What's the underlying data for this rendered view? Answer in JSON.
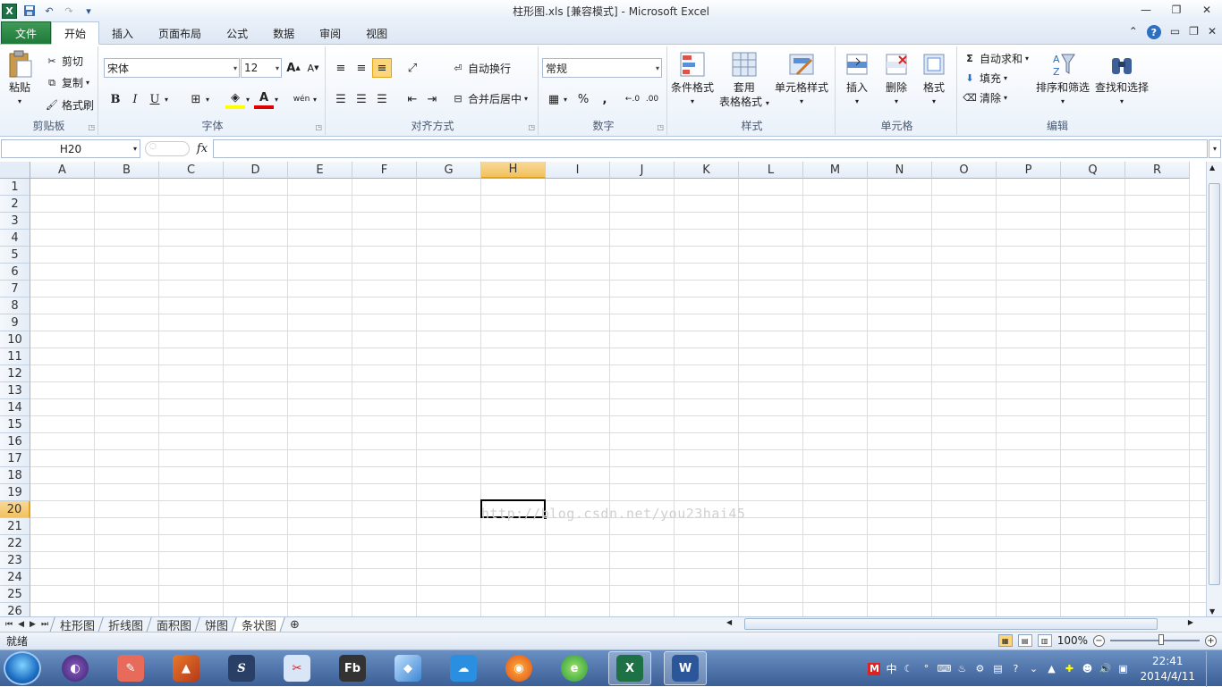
{
  "window": {
    "title": "柱形图.xls  [兼容模式] - Microsoft Excel",
    "controls": {
      "minimize": "—",
      "restore": "❐",
      "close": "✕"
    }
  },
  "quick_access": {
    "icons": [
      "excel-icon",
      "save-icon",
      "undo-icon",
      "redo-icon",
      "customize-icon"
    ]
  },
  "tabs": [
    {
      "label": "文件"
    },
    {
      "label": "开始"
    },
    {
      "label": "插入"
    },
    {
      "label": "页面布局"
    },
    {
      "label": "公式"
    },
    {
      "label": "数据"
    },
    {
      "label": "审阅"
    },
    {
      "label": "视图"
    }
  ],
  "active_tab": "开始",
  "ribbon": {
    "clipboard": {
      "label": "剪贴板",
      "paste": "粘贴",
      "cut": "剪切",
      "copy": "复制",
      "painter": "格式刷"
    },
    "font": {
      "label": "字体",
      "name": "宋体",
      "size": "12",
      "bold": "B",
      "italic": "I",
      "underline": "U",
      "grow": "A",
      "shrink": "A",
      "color": "A",
      "wen": "wén"
    },
    "alignment": {
      "label": "对齐方式",
      "wrap": "自动换行",
      "merge": "合并后居中"
    },
    "number": {
      "label": "数字",
      "format": "常规",
      "percent": "%",
      "comma": ","
    },
    "styles": {
      "label": "样式",
      "conditional": "条件格式",
      "table1": "套用",
      "table2": "表格格式",
      "cell": "单元格样式"
    },
    "cells": {
      "label": "单元格",
      "insert": "插入",
      "delete": "删除",
      "format": "格式"
    },
    "editing": {
      "label": "编辑",
      "autosum": "自动求和",
      "fill": "填充",
      "clear": "清除",
      "sort": "排序和筛选",
      "find": "查找和选择"
    }
  },
  "formula_bar": {
    "name_box": "H20",
    "fx": "fx",
    "formula": ""
  },
  "grid": {
    "columns": [
      "A",
      "B",
      "C",
      "D",
      "E",
      "F",
      "G",
      "H",
      "I",
      "J",
      "K",
      "L",
      "M",
      "N",
      "O",
      "P",
      "Q",
      "R"
    ],
    "rows": [
      "1",
      "2",
      "3",
      "4",
      "5",
      "6",
      "7",
      "8",
      "9",
      "10",
      "11",
      "12",
      "13",
      "14",
      "15",
      "16",
      "17",
      "18",
      "19",
      "20",
      "21",
      "22",
      "23",
      "24",
      "25",
      "26"
    ],
    "selected_column": "H",
    "selected_row": "20",
    "watermark": "http://blog.csdn.net/you23hai45"
  },
  "sheets": [
    {
      "label": "柱形图"
    },
    {
      "label": "折线图"
    },
    {
      "label": "面积图"
    },
    {
      "label": "饼图"
    },
    {
      "label": "条状图"
    }
  ],
  "active_sheet": "条状图",
  "status": {
    "ready": "就绪",
    "zoom": "100%"
  },
  "taskbar": {
    "apps": [
      "eclipse-icon",
      "sticky-icon",
      "matlab-icon",
      "s-app-icon",
      "scissors-icon",
      "fb-icon",
      "cube-icon",
      "cloud-icon",
      "firefox-icon",
      "ie-icon",
      "excel-icon",
      "word-icon"
    ],
    "time": "22:41",
    "date": "2014/4/11",
    "ime": "中"
  },
  "colors": {
    "accent": "#1f7a3a",
    "selected_header": "#f1c15f",
    "taskbar": "#3b5f96"
  }
}
